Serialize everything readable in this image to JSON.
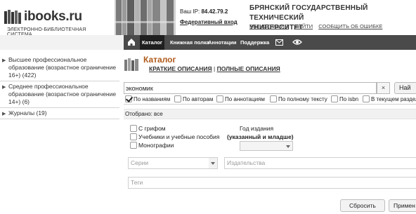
{
  "header": {
    "logo": {
      "name": "ibooks.ru",
      "subtitle": "ЭЛЕКТРОННО-БИБЛИОТЕЧНАЯ СИСТЕМА"
    },
    "ip_label": "Ваш IP:",
    "ip_value": "84.42.79.2",
    "federated_login": "Федеративный вход",
    "university_line1": "БРЯНСКИЙ ГОСУДАРСТВЕННЫЙ ТЕХНИЧЕСКИЙ",
    "university_line2": "УНИВЕРСИТЕТ",
    "links": [
      "РЕГИСТРАЦИЯ",
      "ВЫЙТИ",
      "СООБЩИТЬ ОБ ОШИБКЕ"
    ]
  },
  "nav": {
    "items": [
      {
        "label": "Каталог",
        "active": true
      },
      {
        "label": "Книжная полка",
        "active": false
      },
      {
        "label": "Аннотации",
        "active": false
      },
      {
        "label": "Поддержка",
        "active": false
      }
    ],
    "icons": [
      "home-icon",
      "mail-icon",
      "eye-icon"
    ]
  },
  "sidebar": {
    "items": [
      {
        "line1": "Высшее профессиональное",
        "line2": "образование (возрастное ограничение",
        "line3": "16+) (422)"
      },
      {
        "line1": "Среднее профессиональное",
        "line2": "образование (возрастное ограничение",
        "line3": "14+) (6)"
      },
      {
        "line1": "Журналы (19)",
        "line2": "",
        "line3": ""
      }
    ]
  },
  "catalog": {
    "title": "Каталог",
    "link_short": "КРАТКИЕ ОПИСАНИЯ",
    "separator": "|",
    "link_full": "ПОЛНЫЕ ОПИСАНИЯ"
  },
  "search": {
    "value": "экономик",
    "clear_label": "×",
    "find_label": "Най"
  },
  "filters": [
    {
      "label": "По названиям",
      "checked": true
    },
    {
      "label": "По авторам",
      "checked": false
    },
    {
      "label": "По аннотациям",
      "checked": false
    },
    {
      "label": "По полному тексту",
      "checked": false
    },
    {
      "label": "По isbn",
      "checked": false
    },
    {
      "label": "В текущем разделе",
      "checked": false
    }
  ],
  "selected": "Отобрано: все",
  "options": [
    {
      "label": "С грифом",
      "checked": false
    },
    {
      "label": "Учебники и учебные пособия",
      "checked": false
    },
    {
      "label": "Монографии",
      "checked": false
    }
  ],
  "year": {
    "label": "Год издания",
    "hint": "(указанный и младше)",
    "value": ""
  },
  "fields": {
    "series_placeholder": "Серии",
    "publisher_placeholder": "Издательства",
    "tags_placeholder": "Теги"
  },
  "buttons": {
    "reset": "Сбросить",
    "apply": "Примен"
  },
  "colors": {
    "nav_bg": "#4a4a4a",
    "nav_active": "#1f1f1f",
    "title_accent": "#b05a1a"
  }
}
